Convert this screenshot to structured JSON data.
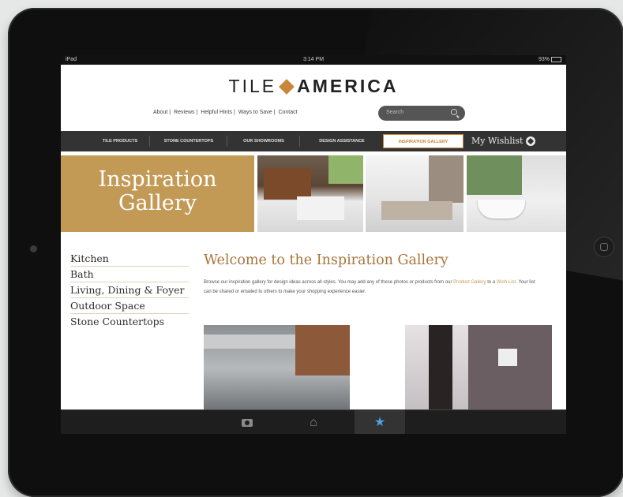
{
  "status_bar": {
    "carrier": "iPad",
    "time": "3:14 PM",
    "battery": "93%"
  },
  "logo": {
    "part1": "TILE",
    "part2": "AMERICA"
  },
  "top_links": [
    "About",
    "Reviews",
    "Helpful Hints",
    "Ways to Save",
    "Contact"
  ],
  "search": {
    "placeholder": "Search"
  },
  "nav": {
    "items": [
      "TILE PRODUCTS",
      "STONE COUNTERTOPS",
      "OUR SHOWROOMS",
      "DESIGN ASSISTANCE",
      "INSPIRATION GALLERY"
    ],
    "active_index": 4,
    "wishlist": "My Wishlist"
  },
  "banner": {
    "line1": "Inspiration",
    "line2": "Gallery"
  },
  "sidebar": {
    "items": [
      "Kitchen",
      "Bath",
      "Living, Dining & Foyer",
      "Outdoor Space",
      "Stone Countertops"
    ]
  },
  "content": {
    "title": "Welcome to the Inspiration Gallery",
    "text_part1": "Browse our inspiration gallery for design ideas across all styles. You may add any of these photos or products from our ",
    "link1": "Product Gallery",
    "text_part2": " to a ",
    "link2": "Wish List",
    "text_part3": ". Your list can be shared or emailed to others to make your shopping experience easier."
  },
  "tabbar": {
    "icons": [
      "camera-icon",
      "home-icon",
      "star-icon"
    ],
    "active_index": 2
  },
  "colors": {
    "accent": "#c29a55",
    "nav_bg": "#333333",
    "tab_active": "#4aa3e8"
  }
}
